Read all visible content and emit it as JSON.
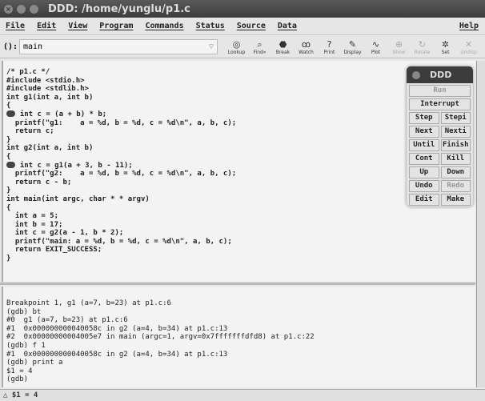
{
  "window": {
    "title": "DDD: /home/yunglu/p1.c"
  },
  "menu": [
    "File",
    "Edit",
    "View",
    "Program",
    "Commands",
    "Status",
    "Source",
    "Data",
    "Help"
  ],
  "toolbar": {
    "arg_label": "():",
    "arg_value": "main",
    "buttons": [
      {
        "label": "Lookup",
        "icon": "lookup-icon",
        "enabled": true
      },
      {
        "label": "Find»",
        "icon": "find-icon",
        "enabled": true
      },
      {
        "label": "Break",
        "icon": "stop-icon",
        "enabled": true
      },
      {
        "label": "Watch",
        "icon": "watch-icon",
        "enabled": true
      },
      {
        "label": "Print",
        "icon": "print-icon",
        "enabled": true
      },
      {
        "label": "Display",
        "icon": "display-icon",
        "enabled": true
      },
      {
        "label": "Plot",
        "icon": "plot-icon",
        "enabled": true
      },
      {
        "label": "Show",
        "icon": "show-icon",
        "enabled": false
      },
      {
        "label": "Rotate",
        "icon": "rotate-icon",
        "enabled": false
      },
      {
        "label": "Set",
        "icon": "set-icon",
        "enabled": true
      },
      {
        "label": "Undisp",
        "icon": "undisp-icon",
        "enabled": false
      }
    ]
  },
  "source": [
    "/* p1.c */",
    "#include <stdio.h>",
    "#include <stdlib.h>",
    "int g1(int a, int b)",
    "{",
    "  int c = (a + b) * b;",
    "  printf(\"g1:    a = %d, b = %d, c = %d\\n\", a, b, c);",
    "  return c;",
    "}",
    "",
    "int g2(int a, int b)",
    "{",
    "  int c = g1(a + 3, b - 11);",
    "  printf(\"g2:    a = %d, b = %d, c = %d\\n\", a, b, c);",
    "  return c - b;",
    "}",
    "",
    "int main(int argc, char * * argv)",
    "{",
    "  int a = 5;",
    "  int b = 17;",
    "  int c = g2(a - 1, b * 2);",
    "  printf(\"main: a = %d, b = %d, c = %d\\n\", a, b, c);",
    "  return EXIT_SUCCESS;",
    "}"
  ],
  "console": [
    "Breakpoint 1, g1 (a=7, b=23) at p1.c:6",
    "(gdb) bt",
    "#0  g1 (a=7, b=23) at p1.c:6",
    "#1  0x000000000040058c in g2 (a=4, b=34) at p1.c:13",
    "#2  0x00000000004005e7 in main (argc=1, argv=0x7fffffffdfd8) at p1.c:22",
    "(gdb) f 1",
    "#1  0x000000000040058c in g2 (a=4, b=34) at p1.c:13",
    "(gdb) print a",
    "$1 = 4",
    "(gdb) "
  ],
  "status": "$1 = 4",
  "panel": {
    "title": "DDD",
    "buttons": [
      {
        "label": "Run",
        "enabled": false,
        "wide": true
      },
      {
        "label": "Interrupt",
        "enabled": true,
        "wide": true
      },
      {
        "label": "Step",
        "enabled": true
      },
      {
        "label": "Stepi",
        "enabled": true
      },
      {
        "label": "Next",
        "enabled": true
      },
      {
        "label": "Nexti",
        "enabled": true
      },
      {
        "label": "Until",
        "enabled": true
      },
      {
        "label": "Finish",
        "enabled": true
      },
      {
        "label": "Cont",
        "enabled": true
      },
      {
        "label": "Kill",
        "enabled": true
      },
      {
        "label": "Up",
        "enabled": true
      },
      {
        "label": "Down",
        "enabled": true
      },
      {
        "label": "Undo",
        "enabled": true
      },
      {
        "label": "Redo",
        "enabled": false
      },
      {
        "label": "Edit",
        "enabled": true
      },
      {
        "label": "Make",
        "enabled": true
      }
    ]
  }
}
